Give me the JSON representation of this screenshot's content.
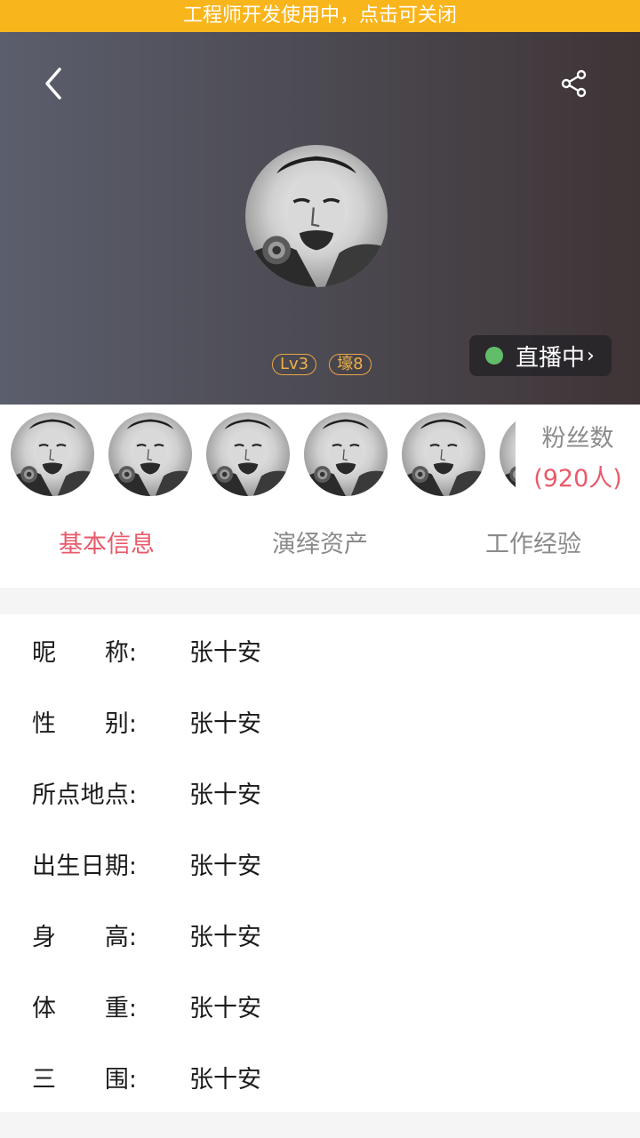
{
  "dev_banner": {
    "text": "工程师开发使用中，点击可关闭",
    "color": "#f9b51c"
  },
  "header": {
    "back_icon": "chevron-left-icon",
    "share_icon": "share-icon",
    "avatar": "profile-avatar",
    "badges": [
      "Lv3",
      "壕8"
    ],
    "live_status": {
      "label": "直播中",
      "chevron": "›",
      "dot_color": "#62bd6a"
    }
  },
  "fans": {
    "avatars": [
      "fan-avatar-1",
      "fan-avatar-2",
      "fan-avatar-3",
      "fan-avatar-4",
      "fan-avatar-5",
      "fan-avatar-6"
    ],
    "label": "粉丝数",
    "count": "(920人)"
  },
  "tabs": [
    {
      "label": "基本信息",
      "active": true
    },
    {
      "label": "演绎资产",
      "active": false
    },
    {
      "label": "工作经验",
      "active": false
    }
  ],
  "profile_fields": [
    {
      "label": "昵称:",
      "value": "张十安"
    },
    {
      "label": "性别:",
      "value": "张十安"
    },
    {
      "label": "所点地点:",
      "value": "张十安"
    },
    {
      "label": "出生日期:",
      "value": "张十安"
    },
    {
      "label": "身高:",
      "value": "张十安"
    },
    {
      "label": "体重:",
      "value": "张十安"
    },
    {
      "label": "三围:",
      "value": "张十安"
    }
  ],
  "colors": {
    "accent": "#e75a6b",
    "banner": "#f9b51c",
    "badge": "#f0b04a"
  }
}
